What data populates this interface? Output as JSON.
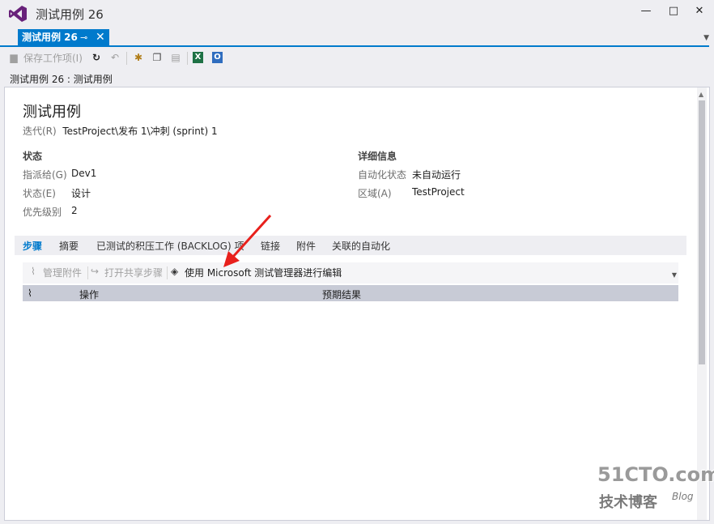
{
  "window": {
    "title": "测试用例 26",
    "minimize": "—",
    "maximize": "□",
    "close": "✕"
  },
  "doc_tab": {
    "label": "测试用例 26",
    "pin": "⊸",
    "close": "✕"
  },
  "toolbar": {
    "save_label": "保存工作项(I)"
  },
  "breadcrumb": "测试用例 26 : 测试用例",
  "form": {
    "title": "测试用例",
    "iteration_label": "迭代(R)",
    "iteration_value": "TestProject\\发布 1\\冲刺 (sprint) 1",
    "status_section": "状态",
    "details_section": "详细信息",
    "fields": {
      "assigned_label": "指派给(G)",
      "assigned_value": "Dev1",
      "state_label": "状态(E)",
      "state_value": "设计",
      "priority_label": "优先级别",
      "priority_value": "2",
      "automation_label": "自动化状态",
      "automation_value": "未自动运行",
      "area_label": "区域(A)",
      "area_value": "TestProject"
    }
  },
  "tabs": [
    {
      "label": "步骤"
    },
    {
      "label": "摘要"
    },
    {
      "label": "已测试的积压工作 (BACKLOG) 项"
    },
    {
      "label": "链接"
    },
    {
      "label": "附件"
    },
    {
      "label": "关联的自动化"
    }
  ],
  "steps_toolbar": {
    "manage_attachments": "管理附件",
    "open_shared_steps": "打开共享步骤",
    "edit_with_mtm": "使用 Microsoft 测试管理器进行编辑"
  },
  "grid": {
    "columns": [
      "操作",
      "预期结果"
    ]
  },
  "watermark": {
    "site": "51CTO.com",
    "sub": "技术博客",
    "blog": "Blog"
  },
  "colors": {
    "accent": "#007acc",
    "annotation_arrow": "#e8201c"
  }
}
